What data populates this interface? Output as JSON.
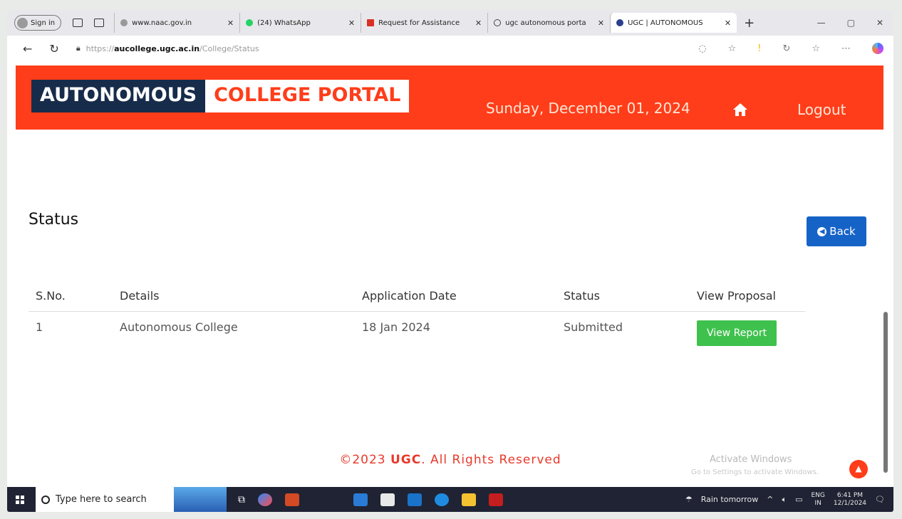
{
  "browser": {
    "signin_label": "Sign in",
    "tabs": [
      {
        "label": "www.naac.gov.in",
        "color": "#999999",
        "active": false
      },
      {
        "label": "(24) WhatsApp",
        "color": "#25d366",
        "active": false
      },
      {
        "label": "Request for Assistance",
        "color": "#d93025",
        "active": false
      },
      {
        "label": "ugc autonomous porta",
        "color": "#4a4a4a",
        "active": false
      },
      {
        "label": "UGC | AUTONOMOUS",
        "color": "#2a3f8f",
        "active": true
      }
    ],
    "new_tab": "+",
    "url_scheme": "https://",
    "url_host": "aucollege.ugc.ac.in",
    "url_path": "/College/Status"
  },
  "header": {
    "logo_part1": "AUTONOMOUS",
    "logo_part2": "COLLEGE PORTAL",
    "date": "Sunday, December 01, 2024",
    "logout": "Logout",
    "colors": {
      "bar": "#ff3d1a",
      "logo_dark": "#172c4a"
    }
  },
  "main": {
    "title": "Status",
    "back_label": "Back",
    "table": {
      "headers": [
        "S.No.",
        "Details",
        "Application Date",
        "Status",
        "View Proposal"
      ],
      "rows": [
        {
          "sno": "1",
          "details": "Autonomous College",
          "date": "18 Jan 2024",
          "status": "Submitted",
          "action": "View Report"
        }
      ]
    }
  },
  "footer": {
    "prefix": "©2023 ",
    "brand": "UGC",
    "suffix": ". All Rights Reserved",
    "watermark_line1": "Activate Windows",
    "watermark_line2": "Go to Settings to activate Windows."
  },
  "taskbar": {
    "search_placeholder": "Type here to search",
    "weather": "Rain tomorrow",
    "lang1": "ENG",
    "lang2": "IN",
    "time": "6:41 PM",
    "date": "12/1/2024"
  }
}
